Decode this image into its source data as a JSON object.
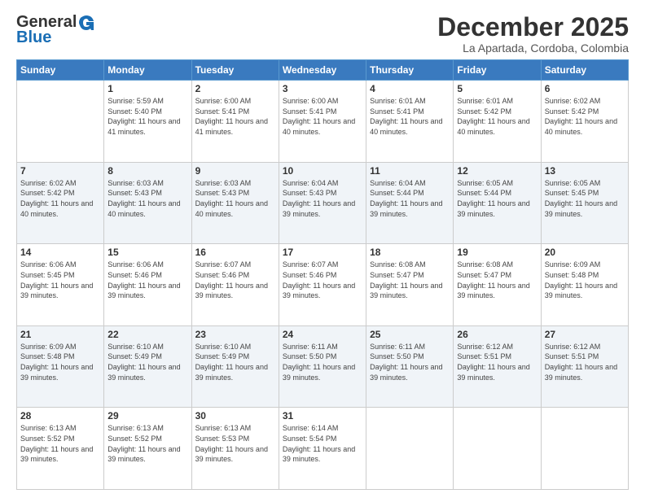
{
  "logo": {
    "general": "General",
    "blue": "Blue"
  },
  "title": "December 2025",
  "location": "La Apartada, Cordoba, Colombia",
  "weekdays": [
    "Sunday",
    "Monday",
    "Tuesday",
    "Wednesday",
    "Thursday",
    "Friday",
    "Saturday"
  ],
  "weeks": [
    [
      {
        "day": "",
        "sunrise": "",
        "sunset": "",
        "daylight": ""
      },
      {
        "day": "1",
        "sunrise": "Sunrise: 5:59 AM",
        "sunset": "Sunset: 5:40 PM",
        "daylight": "Daylight: 11 hours and 41 minutes."
      },
      {
        "day": "2",
        "sunrise": "Sunrise: 6:00 AM",
        "sunset": "Sunset: 5:41 PM",
        "daylight": "Daylight: 11 hours and 41 minutes."
      },
      {
        "day": "3",
        "sunrise": "Sunrise: 6:00 AM",
        "sunset": "Sunset: 5:41 PM",
        "daylight": "Daylight: 11 hours and 40 minutes."
      },
      {
        "day": "4",
        "sunrise": "Sunrise: 6:01 AM",
        "sunset": "Sunset: 5:41 PM",
        "daylight": "Daylight: 11 hours and 40 minutes."
      },
      {
        "day": "5",
        "sunrise": "Sunrise: 6:01 AM",
        "sunset": "Sunset: 5:42 PM",
        "daylight": "Daylight: 11 hours and 40 minutes."
      },
      {
        "day": "6",
        "sunrise": "Sunrise: 6:02 AM",
        "sunset": "Sunset: 5:42 PM",
        "daylight": "Daylight: 11 hours and 40 minutes."
      }
    ],
    [
      {
        "day": "7",
        "sunrise": "Sunrise: 6:02 AM",
        "sunset": "Sunset: 5:42 PM",
        "daylight": "Daylight: 11 hours and 40 minutes."
      },
      {
        "day": "8",
        "sunrise": "Sunrise: 6:03 AM",
        "sunset": "Sunset: 5:43 PM",
        "daylight": "Daylight: 11 hours and 40 minutes."
      },
      {
        "day": "9",
        "sunrise": "Sunrise: 6:03 AM",
        "sunset": "Sunset: 5:43 PM",
        "daylight": "Daylight: 11 hours and 40 minutes."
      },
      {
        "day": "10",
        "sunrise": "Sunrise: 6:04 AM",
        "sunset": "Sunset: 5:43 PM",
        "daylight": "Daylight: 11 hours and 39 minutes."
      },
      {
        "day": "11",
        "sunrise": "Sunrise: 6:04 AM",
        "sunset": "Sunset: 5:44 PM",
        "daylight": "Daylight: 11 hours and 39 minutes."
      },
      {
        "day": "12",
        "sunrise": "Sunrise: 6:05 AM",
        "sunset": "Sunset: 5:44 PM",
        "daylight": "Daylight: 11 hours and 39 minutes."
      },
      {
        "day": "13",
        "sunrise": "Sunrise: 6:05 AM",
        "sunset": "Sunset: 5:45 PM",
        "daylight": "Daylight: 11 hours and 39 minutes."
      }
    ],
    [
      {
        "day": "14",
        "sunrise": "Sunrise: 6:06 AM",
        "sunset": "Sunset: 5:45 PM",
        "daylight": "Daylight: 11 hours and 39 minutes."
      },
      {
        "day": "15",
        "sunrise": "Sunrise: 6:06 AM",
        "sunset": "Sunset: 5:46 PM",
        "daylight": "Daylight: 11 hours and 39 minutes."
      },
      {
        "day": "16",
        "sunrise": "Sunrise: 6:07 AM",
        "sunset": "Sunset: 5:46 PM",
        "daylight": "Daylight: 11 hours and 39 minutes."
      },
      {
        "day": "17",
        "sunrise": "Sunrise: 6:07 AM",
        "sunset": "Sunset: 5:46 PM",
        "daylight": "Daylight: 11 hours and 39 minutes."
      },
      {
        "day": "18",
        "sunrise": "Sunrise: 6:08 AM",
        "sunset": "Sunset: 5:47 PM",
        "daylight": "Daylight: 11 hours and 39 minutes."
      },
      {
        "day": "19",
        "sunrise": "Sunrise: 6:08 AM",
        "sunset": "Sunset: 5:47 PM",
        "daylight": "Daylight: 11 hours and 39 minutes."
      },
      {
        "day": "20",
        "sunrise": "Sunrise: 6:09 AM",
        "sunset": "Sunset: 5:48 PM",
        "daylight": "Daylight: 11 hours and 39 minutes."
      }
    ],
    [
      {
        "day": "21",
        "sunrise": "Sunrise: 6:09 AM",
        "sunset": "Sunset: 5:48 PM",
        "daylight": "Daylight: 11 hours and 39 minutes."
      },
      {
        "day": "22",
        "sunrise": "Sunrise: 6:10 AM",
        "sunset": "Sunset: 5:49 PM",
        "daylight": "Daylight: 11 hours and 39 minutes."
      },
      {
        "day": "23",
        "sunrise": "Sunrise: 6:10 AM",
        "sunset": "Sunset: 5:49 PM",
        "daylight": "Daylight: 11 hours and 39 minutes."
      },
      {
        "day": "24",
        "sunrise": "Sunrise: 6:11 AM",
        "sunset": "Sunset: 5:50 PM",
        "daylight": "Daylight: 11 hours and 39 minutes."
      },
      {
        "day": "25",
        "sunrise": "Sunrise: 6:11 AM",
        "sunset": "Sunset: 5:50 PM",
        "daylight": "Daylight: 11 hours and 39 minutes."
      },
      {
        "day": "26",
        "sunrise": "Sunrise: 6:12 AM",
        "sunset": "Sunset: 5:51 PM",
        "daylight": "Daylight: 11 hours and 39 minutes."
      },
      {
        "day": "27",
        "sunrise": "Sunrise: 6:12 AM",
        "sunset": "Sunset: 5:51 PM",
        "daylight": "Daylight: 11 hours and 39 minutes."
      }
    ],
    [
      {
        "day": "28",
        "sunrise": "Sunrise: 6:13 AM",
        "sunset": "Sunset: 5:52 PM",
        "daylight": "Daylight: 11 hours and 39 minutes."
      },
      {
        "day": "29",
        "sunrise": "Sunrise: 6:13 AM",
        "sunset": "Sunset: 5:52 PM",
        "daylight": "Daylight: 11 hours and 39 minutes."
      },
      {
        "day": "30",
        "sunrise": "Sunrise: 6:13 AM",
        "sunset": "Sunset: 5:53 PM",
        "daylight": "Daylight: 11 hours and 39 minutes."
      },
      {
        "day": "31",
        "sunrise": "Sunrise: 6:14 AM",
        "sunset": "Sunset: 5:54 PM",
        "daylight": "Daylight: 11 hours and 39 minutes."
      },
      {
        "day": "",
        "sunrise": "",
        "sunset": "",
        "daylight": ""
      },
      {
        "day": "",
        "sunrise": "",
        "sunset": "",
        "daylight": ""
      },
      {
        "day": "",
        "sunrise": "",
        "sunset": "",
        "daylight": ""
      }
    ]
  ]
}
